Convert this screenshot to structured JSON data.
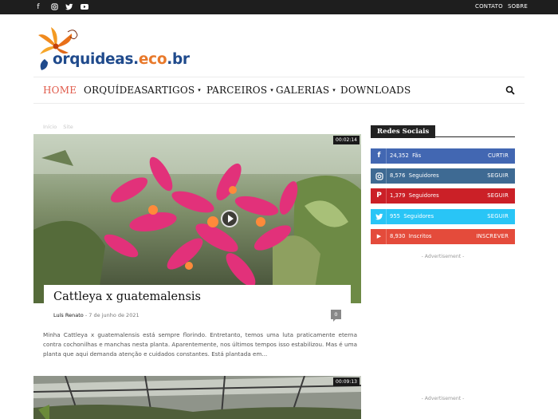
{
  "topbar": {
    "social_icons": [
      "facebook-icon",
      "instagram-icon",
      "twitter-icon",
      "youtube-icon"
    ],
    "links": {
      "contact": "CONTATO",
      "about": "SOBRE"
    }
  },
  "logo": {
    "part1": "orquideas.",
    "part2": "eco",
    "part3": ".br"
  },
  "nav": {
    "items": [
      {
        "label": "HOME",
        "active": true,
        "dropdown": false
      },
      {
        "label": "ORQUÍDEAS",
        "active": false,
        "dropdown": false
      },
      {
        "label": "ARTIGOS",
        "active": false,
        "dropdown": true
      },
      {
        "label": "PARCEIROS",
        "active": false,
        "dropdown": true
      },
      {
        "label": "GALERIAS",
        "active": false,
        "dropdown": true
      },
      {
        "label": "DOWNLOADS",
        "active": false,
        "dropdown": false
      }
    ],
    "caret": "▾"
  },
  "breadcrumb": [
    "Início",
    "Site"
  ],
  "articles": [
    {
      "duration": "00:02:14",
      "title": "Cattleya x guatemalensis",
      "author": "Luís Renato",
      "separator": "-",
      "date": "7 de junho de 2021",
      "comments": "0",
      "excerpt": "Minha Cattleya x guatemalensis está sempre florindo. Entretanto, temos uma luta praticamente eterna contra cochonilhas e manchas nesta planta. Aparentemente, nos últimos tempos isso estabilizou. Mas é uma planta que aqui demanda atenção e cuidados constantes. Está plantada em..."
    },
    {
      "duration": "00:09:13"
    }
  ],
  "sidebar": {
    "widget_title": "Redes Sociais",
    "social": [
      {
        "network": "facebook",
        "icon": "f",
        "count": "24,352",
        "unit": "Fãs",
        "action": "CURTIR",
        "color": "#4267b2"
      },
      {
        "network": "instagram",
        "icon": "◎",
        "count": "8,576",
        "unit": "Seguidores",
        "action": "SEGUIR",
        "color": "#3e6a93"
      },
      {
        "network": "pinterest",
        "icon": "P",
        "count": "1,379",
        "unit": "Seguidores",
        "action": "SEGUIR",
        "color": "#cb2027"
      },
      {
        "network": "twitter",
        "icon": "t",
        "count": "955",
        "unit": "Seguidores",
        "action": "SEGUIR",
        "color": "#29c5f6"
      },
      {
        "network": "youtube",
        "icon": "▶",
        "count": "8,930",
        "unit": "Inscritos",
        "action": "INSCREVER",
        "color": "#e44b3b"
      }
    ],
    "ad_label": "- Advertisement -"
  },
  "colors": {
    "accent": "#e05a4a",
    "topbar": "#1e1e1e"
  }
}
